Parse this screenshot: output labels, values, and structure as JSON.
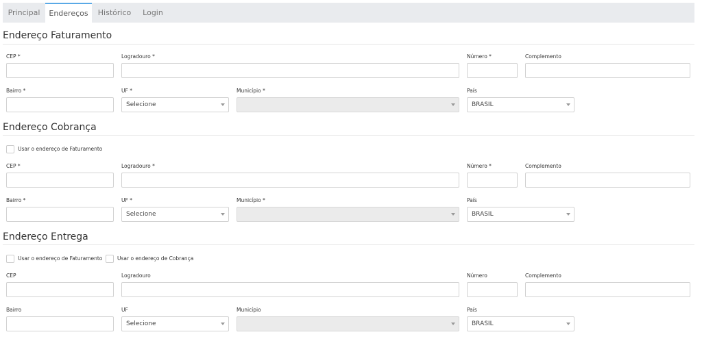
{
  "tabs": [
    {
      "label": "Principal"
    },
    {
      "label": "Endereços"
    },
    {
      "label": "Histórico"
    },
    {
      "label": "Login"
    }
  ],
  "sections": {
    "faturamento": {
      "title": "Endereço Faturamento",
      "labels": {
        "cep": "CEP *",
        "logradouro": "Logradouro *",
        "numero": "Número *",
        "complemento": "Complemento",
        "bairro": "Bairro *",
        "uf": "UF *",
        "municipio": "Município *",
        "pais": "País"
      },
      "uf_value": "Selecione",
      "pais_value": "BRASIL"
    },
    "cobranca": {
      "title": "Endereço Cobrança",
      "checkbox_faturamento": "Usar o endereço de Faturamento",
      "labels": {
        "cep": "CEP *",
        "logradouro": "Logradouro *",
        "numero": "Número *",
        "complemento": "Complemento",
        "bairro": "Bairro *",
        "uf": "UF *",
        "municipio": "Município *",
        "pais": "País"
      },
      "uf_value": "Selecione",
      "pais_value": "BRASIL"
    },
    "entrega": {
      "title": "Endereço Entrega",
      "checkbox_faturamento": "Usar o endereço de Faturamento",
      "checkbox_cobranca": "Usar o endereço de Cobrança",
      "labels": {
        "cep": "CEP",
        "logradouro": "Logradouro",
        "numero": "Número",
        "complemento": "Complemento",
        "bairro": "Bairro",
        "uf": "UF",
        "municipio": "Município",
        "pais": "País"
      },
      "uf_value": "Selecione",
      "pais_value": "BRASIL"
    }
  }
}
